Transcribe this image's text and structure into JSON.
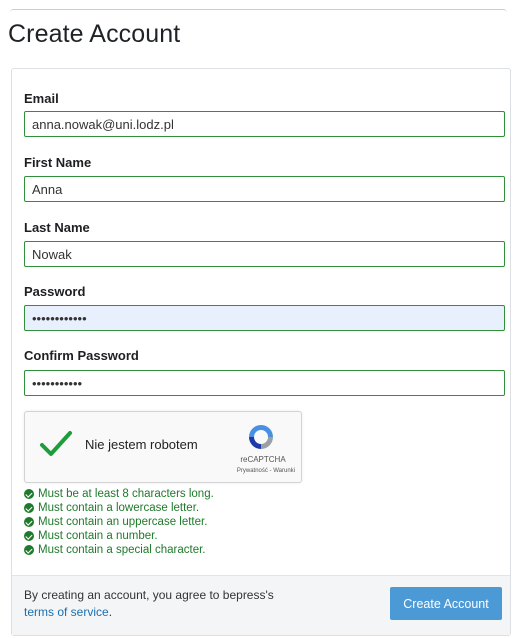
{
  "page": {
    "title": "Create Account"
  },
  "form": {
    "email": {
      "label": "Email",
      "value": "anna.nowak@uni.lodz.pl"
    },
    "first_name": {
      "label": "First Name",
      "value": "Anna"
    },
    "last_name": {
      "label": "Last Name",
      "value": "Nowak"
    },
    "password": {
      "label": "Password",
      "value": "passwordvalu"
    },
    "confirm_password": {
      "label": "Confirm Password",
      "value": "passwordval"
    }
  },
  "captcha": {
    "label": "Nie jestem robotem",
    "brand": "reCAPTCHA",
    "links": "Prywatność - Warunki",
    "checked": true
  },
  "password_rules": [
    "Must be at least 8 characters long.",
    "Must contain a lowercase letter.",
    "Must contain an uppercase letter.",
    "Must contain a number.",
    "Must contain a special character."
  ],
  "footer": {
    "agree_text": "By creating an account, you agree to bepress's",
    "terms_link": "terms of service",
    "terms_suffix": ".",
    "submit_label": "Create Account"
  },
  "colors": {
    "accent": "#4b9ad6",
    "valid": "#1f7a2b",
    "field_border": "#2f8f3b",
    "link": "#1a6fb0"
  },
  "icons": {
    "captcha_check": "check-icon",
    "captcha_logo": "recaptcha-icon",
    "rule_ok": "check-circle-icon"
  }
}
